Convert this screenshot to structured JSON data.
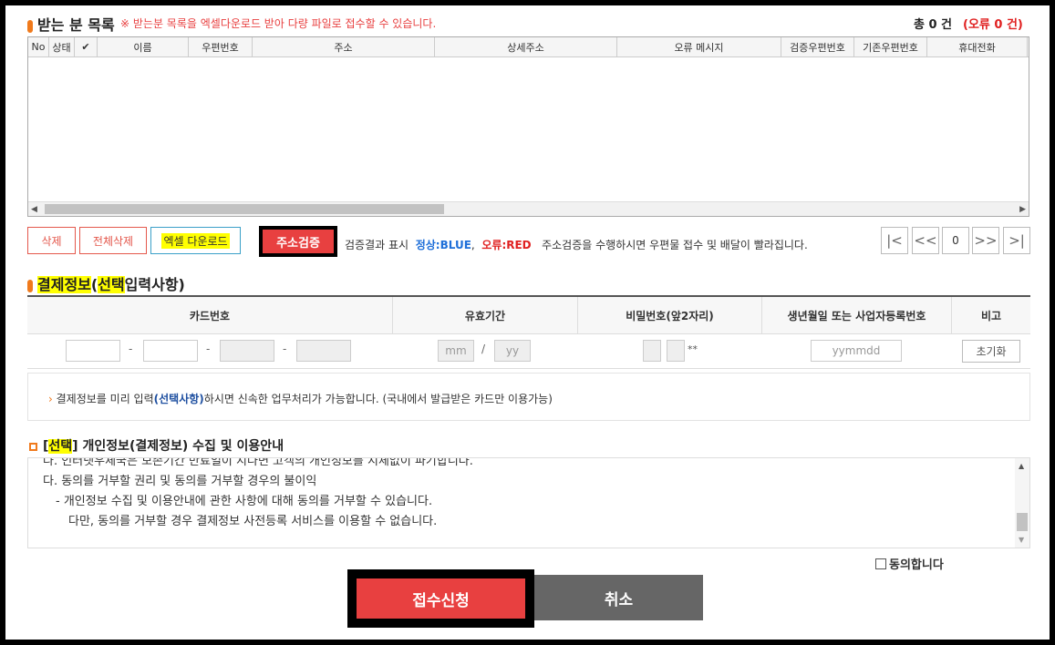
{
  "recipients": {
    "title": "받는 분 목록",
    "notice": "※ 받는분 목록을 엑셀다운로드 받아 다량 파일로 접수할 수 있습니다.",
    "total_label": "총 0 건",
    "error_label": "(오류 0 건)",
    "columns": [
      "No",
      "상태",
      "✔",
      "이름",
      "우편번호",
      "주소",
      "상세주소",
      "오류 메시지",
      "검증우편번호",
      "기존우편번호",
      "휴대전화"
    ]
  },
  "actions": {
    "delete": "삭제",
    "delete_all": "전체삭제",
    "excel_download": "엑셀 다운로드",
    "verify_address": "주소검증",
    "result_label": "검증결과 표시",
    "normal_label": "정상:BLUE",
    "comma": ",",
    "error_label": "오류:RED",
    "verify_note": "주소검증을 수행하시면 우편물 접수 및 배달이 빨라집니다."
  },
  "pager": {
    "first": "|<",
    "prev": "<<",
    "page": "0",
    "next": ">>",
    "last": ">|"
  },
  "payment": {
    "title_part1": "결제정보",
    "title_open": "(",
    "title_highlight": "선택",
    "title_part2": "입력사항)",
    "headers": [
      "카드번호",
      "유효기간",
      "비밀번호(앞2자리)",
      "생년월일 또는 사업자등록번호",
      "비고"
    ],
    "dash": "-",
    "mm_placeholder": "mm",
    "slash": "/",
    "yy_placeholder": "yy",
    "pw_mask": "**",
    "birth_placeholder": "yymmdd",
    "reset": "초기화",
    "info_arrow": "›",
    "info_part1": "결제정보를 미리 입력",
    "info_highlight": "(선택사항)",
    "info_part2": "하시면 신속한 업무처리가 가능합니다. (국내에서 발급받은 카드만 이용가능)"
  },
  "privacy": {
    "title_open": "[",
    "title_highlight": "선택",
    "title_close": "]",
    "title_rest": "개인정보(결제정보) 수집 및 이용안내",
    "lines": [
      "나. 인터넷우체국은 보존기간 만료일이 지나면 고객의 개인정보를 지체없이 파기합니다.",
      "다. 동의를 거부할 권리 및 동의를 거부할 경우의 불이익",
      "- 개인정보 수집 및 이용안내에 관한 사항에 대해 동의를 거부할 수 있습니다.",
      "다만, 동의를 거부할 경우 결제정보 사전등록 서비스를 이용할 수 없습니다."
    ],
    "agree_label": "동의합니다"
  },
  "footer": {
    "submit": "접수신청",
    "cancel": "취소"
  },
  "colors": {
    "accent": "#e84040",
    "blue": "#1e6fd9",
    "highlight": "#ffff00",
    "orange": "#f07a1c"
  }
}
